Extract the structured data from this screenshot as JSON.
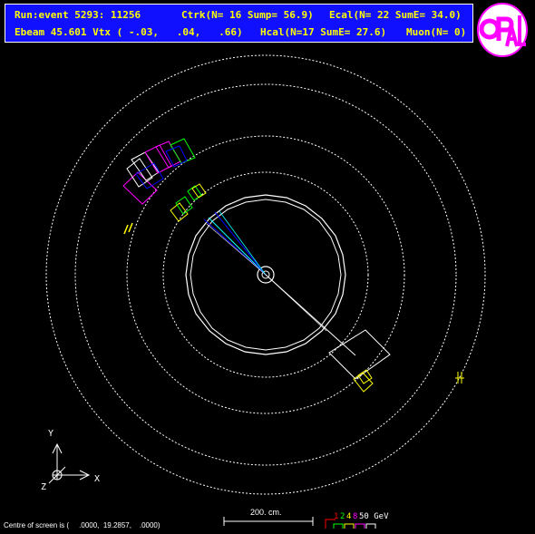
{
  "header": {
    "line1_run": "Run:event 5293: 11256",
    "line1_ctrk": "Ctrk(N= 16 Sump= 56.9)",
    "line1_ecal": "Ecal(N= 22 SumE= 34.0)",
    "line2_ebeam": "Ebeam 45.601 Vtx ( -.03,   .04,   .66)",
    "line2_hcal": "Hcal(N=17 SumE= 27.6)",
    "line2_muon": "Muon(N= 0)"
  },
  "logo": {
    "text": "OPAL",
    "colors": {
      "bg": "#ffffff",
      "letters": "#ff00ff"
    }
  },
  "axes": {
    "y_label": "Y",
    "x_label": "X",
    "z_label": "Z"
  },
  "scale": {
    "label": "200. cm."
  },
  "energy_scale": {
    "labels": [
      "1",
      "2",
      "4",
      "8",
      "50 GeV"
    ],
    "colors": [
      "#ff0000",
      "#00ff00",
      "#ffff00",
      "#ff00ff",
      "#ffffff"
    ]
  },
  "footer": {
    "centre_text": "Centre of screen is (     .0000,  19.2857,    .0000)"
  },
  "colors": {
    "background": "#000000",
    "header_bg": "#1010ff",
    "header_text": "#ffff00",
    "detector": "#ffffff",
    "track": "#00ffff"
  }
}
